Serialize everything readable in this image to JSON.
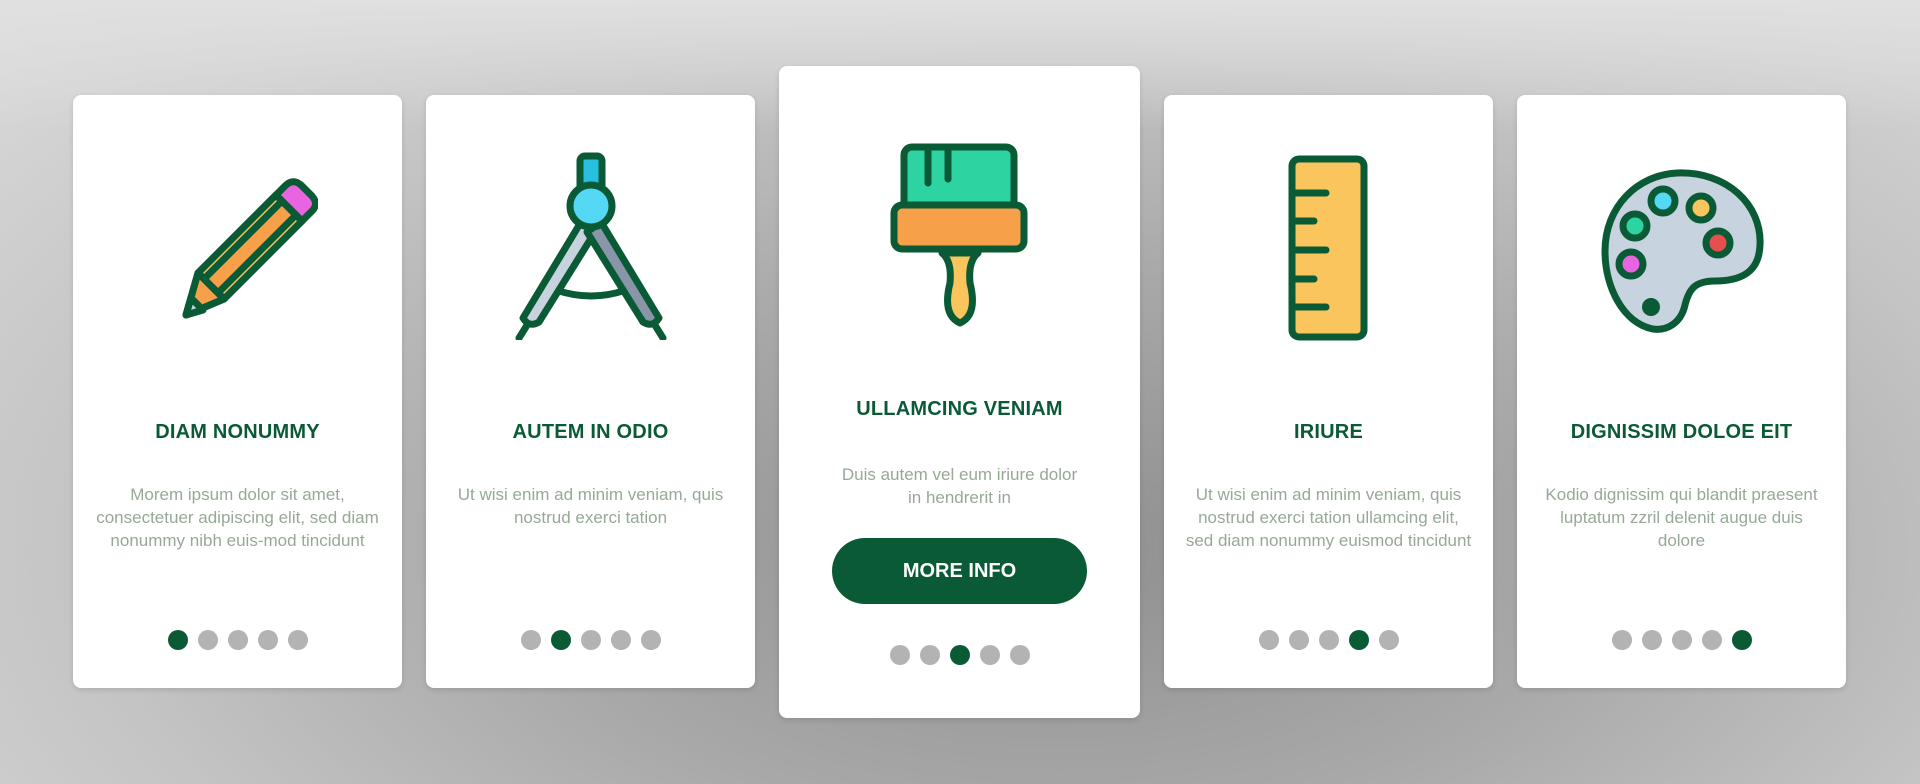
{
  "colors": {
    "accent": "#0b5a36",
    "body_text": "#97a996",
    "dot_inactive": "#b3b3b3",
    "card_bg": "#ffffff"
  },
  "cards": [
    {
      "icon": "pencil-icon",
      "title": "DIAM NONUMMY",
      "body": "Morem ipsum dolor sit amet, consectetuer adipiscing elit, sed diam nonummy nibh euis-mod tincidunt",
      "active_dot": 1
    },
    {
      "icon": "compass-icon",
      "title": "AUTEM IN ODIO",
      "body": "Ut wisi enim ad minim veniam, quis nostrud exerci tation",
      "active_dot": 2
    },
    {
      "icon": "paint-brush-icon",
      "title": "ULLAMCING VENIAM",
      "body": "Duis autem vel eum iriure dolor in hendrerit in",
      "button": "MORE INFO",
      "active_dot": 3
    },
    {
      "icon": "ruler-icon",
      "title": "IRIURE",
      "body": "Ut wisi enim ad minim veniam, quis nostrud exerci tation ullamcing elit, sed diam nonummy euismod tincidunt",
      "active_dot": 4
    },
    {
      "icon": "palette-icon",
      "title": "DIGNISSIM DOLOE EIT",
      "body": "Kodio dignissim qui blandit praesent luptatum zzril delenit augue duis dolore",
      "active_dot": 5
    }
  ],
  "pagination": {
    "total_pages": 5
  }
}
